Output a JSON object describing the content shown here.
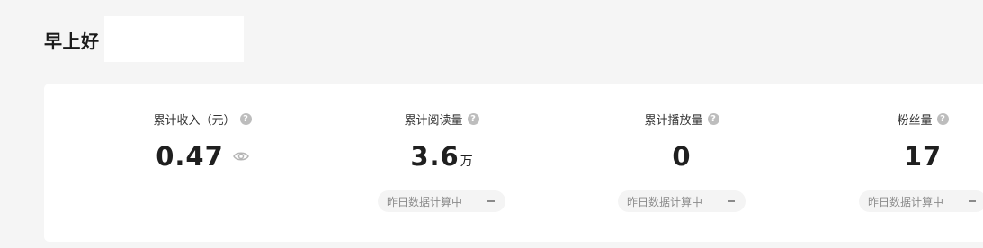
{
  "header": {
    "greeting": "早上好"
  },
  "stats": [
    {
      "label": "累计收入（元）",
      "value": "0.47",
      "unit": "",
      "help_icon": "question-circle-icon",
      "extra_icon": "eye-icon",
      "pill": ""
    },
    {
      "label": "累计阅读量",
      "value": "3.6",
      "unit": "万",
      "help_icon": "question-circle-icon",
      "pill": "昨日数据计算中",
      "pill_trend": "−"
    },
    {
      "label": "累计播放量",
      "value": "0",
      "unit": "",
      "help_icon": "question-circle-icon",
      "pill": "昨日数据计算中",
      "pill_trend": "−"
    },
    {
      "label": "粉丝量",
      "value": "17",
      "unit": "",
      "help_icon": "question-circle-icon",
      "pill": "昨日数据计算中",
      "pill_trend": "−"
    }
  ],
  "colors": {
    "page_bg": "#f5f5f5",
    "card_bg": "#ffffff",
    "value_text": "#1f1f1f",
    "muted_text": "#8a8a8a",
    "help_icon_bg": "#bdbdbd"
  }
}
